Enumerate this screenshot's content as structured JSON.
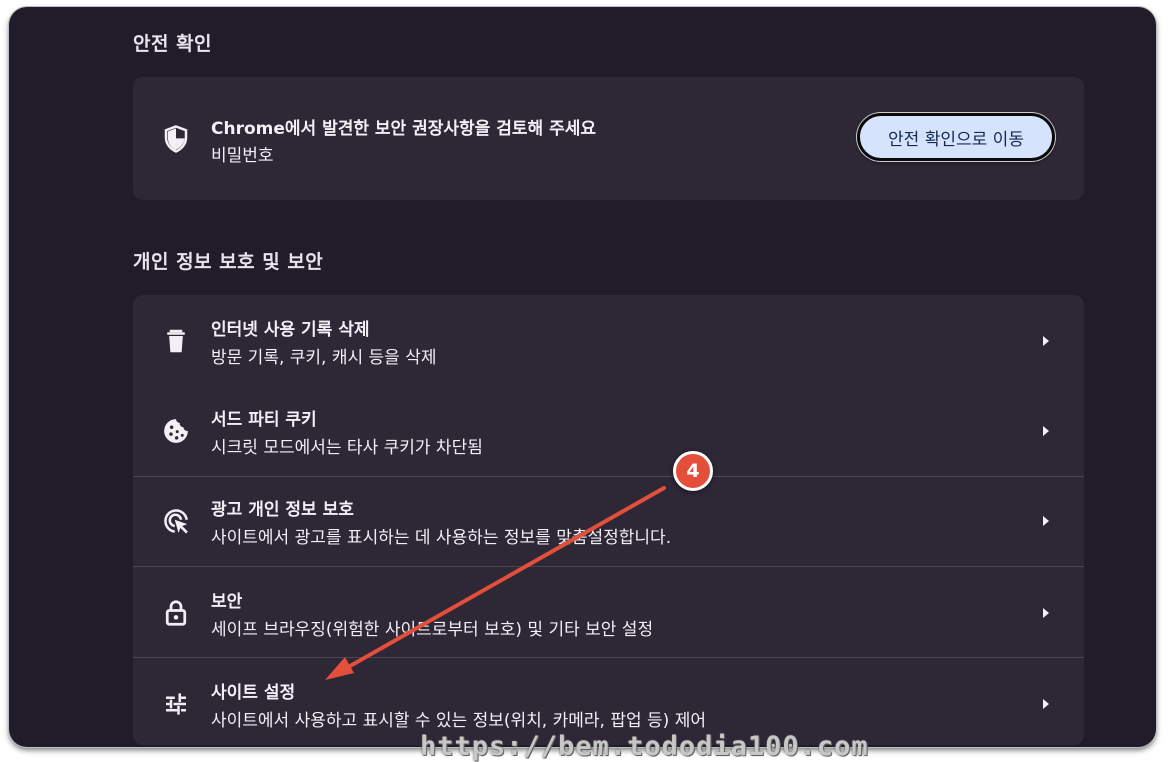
{
  "safety_check": {
    "section_title": "안전 확인",
    "title": "Chrome에서 발견한 보안 권장사항을 검토해 주세요",
    "subtitle": "비밀번호",
    "button_label": "안전 확인으로 이동",
    "icon": "shield-icon"
  },
  "privacy": {
    "section_title": "개인 정보 보호 및 보안",
    "items": [
      {
        "title": "인터넷 사용 기록 삭제",
        "subtitle": "방문 기록, 쿠키, 캐시 등을 삭제",
        "icon": "trash-icon"
      },
      {
        "title": "서드 파티 쿠키",
        "subtitle": "시크릿 모드에서는 타사 쿠키가 차단됨",
        "icon": "cookie-icon"
      },
      {
        "title": "광고 개인 정보 보호",
        "subtitle": "사이트에서 광고를 표시하는 데 사용하는 정보를 맞춤설정합니다.",
        "icon": "ad-target-icon"
      },
      {
        "title": "보안",
        "subtitle": "세이프 브라우징(위험한 사이트로부터 보호) 및 기타 보안 설정",
        "icon": "lock-icon"
      },
      {
        "title": "사이트 설정",
        "subtitle": "사이트에서 사용하고 표시할 수 있는 정보(위치, 카메라, 팝업 등) 제어",
        "icon": "sliders-icon"
      }
    ]
  },
  "annotation": {
    "step_number": "4",
    "color": "#e34f3a"
  },
  "watermark": "https://bem.tododia100.com",
  "colors": {
    "background": "#211c29",
    "card": "#2d2736",
    "button": "#d5e3fc"
  }
}
